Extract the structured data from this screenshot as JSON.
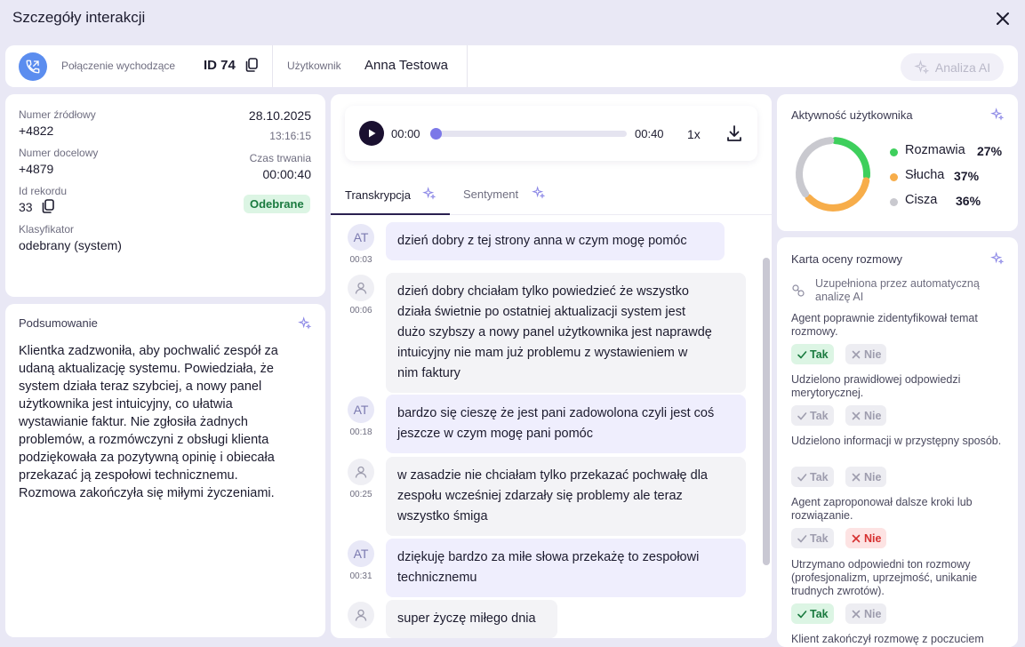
{
  "header": {
    "title": "Szczegóły interakcji"
  },
  "topbar": {
    "call_type": "Połączenie wychodzące",
    "call_id": "ID 74",
    "user_label": "Użytkownik",
    "user_name": "Anna Testowa",
    "ai_button": "Analiza AI"
  },
  "details": {
    "source_label": "Numer źródłowy",
    "source_value": "+4822",
    "target_label": "Numer docelowy",
    "target_value": "+4879",
    "record_label": "Id rekordu",
    "record_value": "33",
    "classifier_label": "Klasyfikator",
    "classifier_value": "odebrany (system)",
    "date": "28.10.2025",
    "time": "13:16:15",
    "duration_label": "Czas trwania",
    "duration_value": "00:00:40",
    "status_badge": "Odebrane"
  },
  "summary": {
    "title": "Podsumowanie",
    "lines": [
      "Klientka zadzwoniła, aby pochwalić zespół za",
      "udaną aktualizację systemu. Powiedziała, że",
      "system działa teraz szybciej, a nowy panel",
      "użytkownika jest intuicyjny, co ułatwia",
      "wystawianie faktur. Nie zgłosiła żadnych",
      "problemów, a rozmówczyni z obsługi klienta",
      "podziękowała za pozytywną opinię i obiecała",
      "przekazać ją zespołowi technicznemu.",
      "Rozmowa zakończyła się miłymi życzeniami."
    ]
  },
  "player": {
    "current": "00:00",
    "total": "00:40",
    "speed": "1x",
    "progress": 0
  },
  "tabs": {
    "transcription": "Transkrypcja",
    "sentiment": "Sentyment"
  },
  "transcript": [
    {
      "speaker": "AT",
      "time": "00:03",
      "lines": [
        "dzień dobry z tej strony anna w czym mogę pomóc"
      ]
    },
    {
      "speaker": "user",
      "time": "00:06",
      "lines": [
        "dzień dobry chciałam tylko powiedzieć że wszystko",
        "działa świetnie po ostatniej aktualizacji system jest",
        "dużo szybszy a nowy panel użytkownika jest naprawdę",
        "intuicyjny nie mam już problemu z wystawieniem w",
        "nim faktury"
      ]
    },
    {
      "speaker": "AT",
      "time": "00:18",
      "lines": [
        "bardzo się cieszę że jest pani zadowolona czyli jest coś",
        "jeszcze w czym mogę pani pomóc"
      ]
    },
    {
      "speaker": "user",
      "time": "00:25",
      "lines": [
        "w zasadzie nie chciałam tylko przekazać pochwałę dla",
        "zespołu wcześniej zdarzały się problemy ale teraz",
        "wszystko śmiga"
      ]
    },
    {
      "speaker": "AT",
      "time": "00:31",
      "lines": [
        "dziękuję bardzo za miłe słowa przekażę to zespołowi",
        "technicznemu"
      ]
    },
    {
      "speaker": "user",
      "time": "",
      "lines": [
        "super życzę miłego dnia"
      ]
    }
  ],
  "activity": {
    "title": "Aktywność użytkownika",
    "items": [
      {
        "name": "Rozmawia",
        "pct": "27%",
        "value": 27,
        "color": "#3ecf5c"
      },
      {
        "name": "Słucha",
        "pct": "37%",
        "value": 37,
        "color": "#f7ad4a"
      },
      {
        "name": "Cisza",
        "pct": "36%",
        "value": 36,
        "color": "#c9c9cf"
      }
    ]
  },
  "scorecard": {
    "title": "Karta oceny rozmowy",
    "ai_note": "Uzupełniona przez automatyczną analizę AI",
    "yes": "Tak",
    "no": "Nie",
    "questions": [
      {
        "text": "Agent poprawnie zidentyfikował temat rozmowy.",
        "answer": "yes"
      },
      {
        "text": "Udzielono prawidłowej odpowiedzi merytorycznej.",
        "answer": "none"
      },
      {
        "text": "Udzielono informacji w przystępny sposób.",
        "answer": "none"
      },
      {
        "text": "Agent zaproponował dalsze kroki lub rozwiązanie.",
        "answer": "no"
      },
      {
        "text": "Utrzymano odpowiedni ton rozmowy (profesjonalizm, uprzejmość, unikanie trudnych zwrotów).",
        "answer": "yes"
      },
      {
        "text": "Klient zakończył rozmowę z poczuciem",
        "answer": "none"
      }
    ]
  }
}
